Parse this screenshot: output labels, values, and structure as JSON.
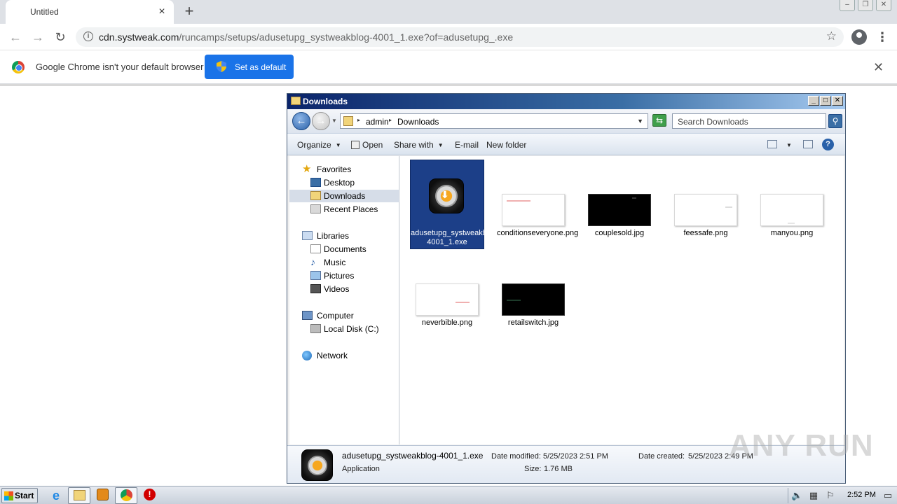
{
  "browser": {
    "tab_title": "Untitled",
    "tab_close": "×",
    "new_tab": "+",
    "window_min": "–",
    "window_restore": "❐",
    "window_close": "✕",
    "url_host": "cdn.systweak.com",
    "url_path": "/runcamps/setups/adusetupg_systweakblog-4001_1.exe?of=adusetupg_.exe",
    "back": "←",
    "forward": "→",
    "reload": "↻",
    "star": "☆",
    "menu": "⋮",
    "infobar": {
      "message": "Google Chrome isn't your default browser",
      "button": "Set as default",
      "close": "✕"
    }
  },
  "explorer": {
    "title": "Downloads",
    "ctrl_min": "_",
    "ctrl_max": "□",
    "ctrl_close": "✕",
    "back": "←",
    "forward": "→",
    "breadcrumbs": [
      "admin",
      "Downloads"
    ],
    "search_placeholder": "Search Downloads",
    "toolbar": {
      "organize": "Organize",
      "open": "Open",
      "share_with": "Share with",
      "email": "E-mail",
      "new_folder": "New folder",
      "help": "?"
    },
    "nav": {
      "favorites": "Favorites",
      "desktop": "Desktop",
      "downloads": "Downloads",
      "recent_places": "Recent Places",
      "libraries": "Libraries",
      "documents": "Documents",
      "music": "Music",
      "pictures": "Pictures",
      "videos": "Videos",
      "computer": "Computer",
      "local_disk": "Local Disk (C:)",
      "network": "Network"
    },
    "files": [
      {
        "name": "adusetupg_systweakblog-4001_1.exe",
        "kind": "app",
        "selected": true
      },
      {
        "name": "conditionseveryone.png",
        "kind": "white"
      },
      {
        "name": "couplesold.jpg",
        "kind": "black"
      },
      {
        "name": "feessafe.png",
        "kind": "white"
      },
      {
        "name": "manyou.png",
        "kind": "white"
      },
      {
        "name": "neverbible.png",
        "kind": "white"
      },
      {
        "name": "retailswitch.jpg",
        "kind": "black"
      }
    ],
    "details": {
      "filename": "adusetupg_systweakblog-4001_1.exe",
      "type": "Application",
      "date_modified_label": "Date modified:",
      "date_modified": "5/25/2023 2:51 PM",
      "size_label": "Size:",
      "size": "1.76 MB",
      "date_created_label": "Date created:",
      "date_created": "5/25/2023 2:49 PM"
    }
  },
  "watermark": "ANY RUN",
  "taskbar": {
    "start": "Start",
    "clock": "2:52 PM",
    "stop_icon_text": "!"
  },
  "colors": {
    "chrome_blue": "#1a73e8",
    "selection": "#1c3f88",
    "title_gradient_start": "#0a246a"
  }
}
